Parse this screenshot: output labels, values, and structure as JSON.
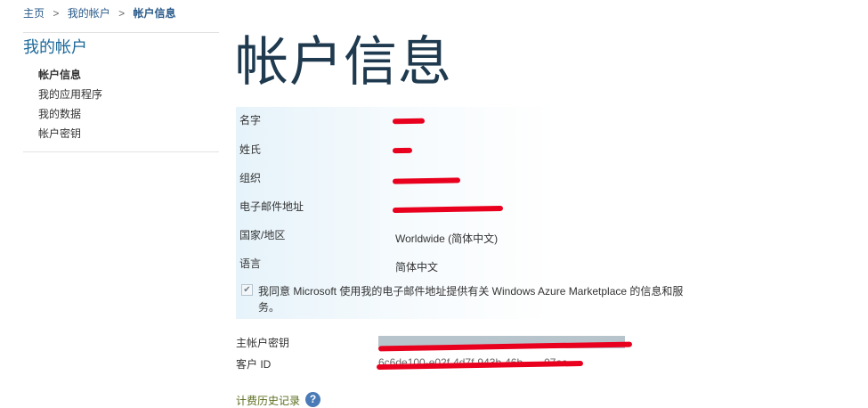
{
  "breadcrumb": {
    "home": "主页",
    "separator": ">",
    "my_account": "我的帐户",
    "current": "帐户信息"
  },
  "sidebar": {
    "title": "我的帐户",
    "items": [
      {
        "label": "帐户信息"
      },
      {
        "label": "我的应用程序"
      },
      {
        "label": "我的数据"
      },
      {
        "label": "帐户密钥"
      }
    ]
  },
  "page": {
    "title": "帐户信息"
  },
  "info": {
    "rows": [
      {
        "label": "名字",
        "value": ""
      },
      {
        "label": "姓氏",
        "value": ""
      },
      {
        "label": "组织",
        "value": ""
      },
      {
        "label": "电子邮件地址",
        "value": ""
      },
      {
        "label": "国家/地区",
        "value": "Worldwide (简体中文)"
      },
      {
        "label": "语言",
        "value": "简体中文"
      }
    ],
    "agree_checked": true,
    "agree_text": "我同意 Microsoft 使用我的电子邮件地址提供有关 Windows Azure Marketplace 的信息和服务。"
  },
  "keys": {
    "primary_key_label": "主帐户密钥",
    "customer_id_label": "客户 ID",
    "customer_id_value": "6c6de100-e02f-4d7f-943b-46b……07ec"
  },
  "billing": {
    "label": "计费历史记录"
  },
  "icons": {
    "help": "help-icon",
    "check": "checkmark-icon"
  },
  "colors": {
    "link": "#2a5a8a",
    "title": "#1f3a4f",
    "sidebar_title": "#1e6a9a",
    "billing_link": "#5a6c1e",
    "redaction": "#e8001e"
  }
}
